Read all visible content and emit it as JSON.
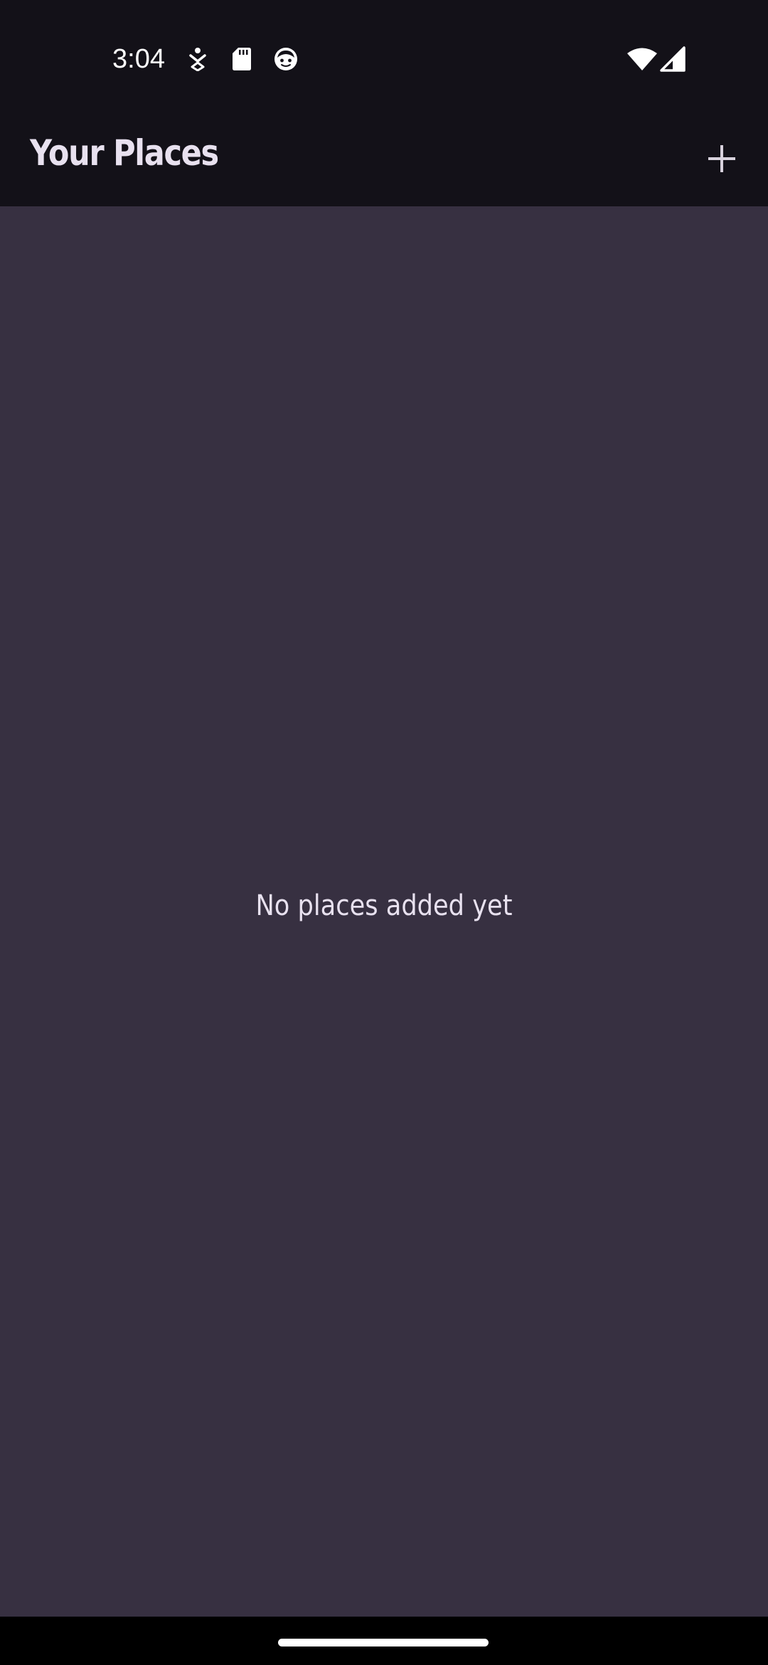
{
  "status_bar": {
    "time": "3:04",
    "icons": [
      "accessibility-download-icon",
      "sd-card-icon",
      "face-icon",
      "wifi-icon",
      "cell-signal-icon"
    ]
  },
  "app_bar": {
    "title": "Your Places",
    "add_icon": "plus-icon"
  },
  "main": {
    "empty_message": "No places added yet"
  },
  "colors": {
    "bar_background": "#131118",
    "content_background": "#373041",
    "text": "#e8e1ef"
  }
}
